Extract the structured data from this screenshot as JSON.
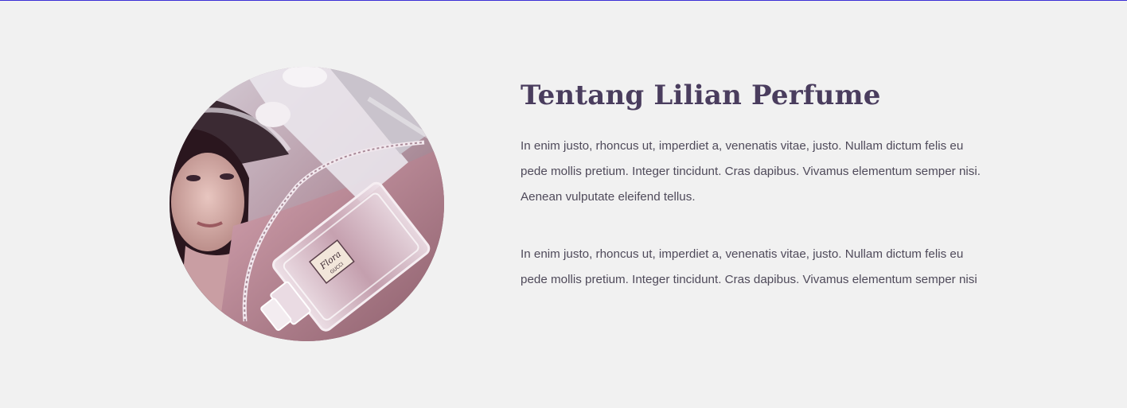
{
  "about": {
    "title": "Tentang Lilian Perfume",
    "paragraph_1": "In enim justo, rhoncus ut, imperdiet a, venenatis vitae, justo. Nullam dictum felis eu pede mollis pretium. Integer tincidunt. Cras dapibus. Vivamus elementum semper nisi. Aenean vulputate eleifend tellus.",
    "paragraph_2": "In enim justo, rhoncus ut, imperdiet a, venenatis vitae, justo. Nullam dictum felis eu pede mollis pretium. Integer tincidunt. Cras dapibus. Vivamus elementum semper nisi",
    "image": {
      "icon": "woman-with-perfume-bottle-photo",
      "bottle_label_script": "Flora",
      "bottle_label_brand": "GUCCI"
    }
  },
  "colors": {
    "background": "#f1f1f1",
    "heading": "#4a3d5e",
    "text": "#4f4a5a",
    "top_border": "#3b2ed6"
  }
}
